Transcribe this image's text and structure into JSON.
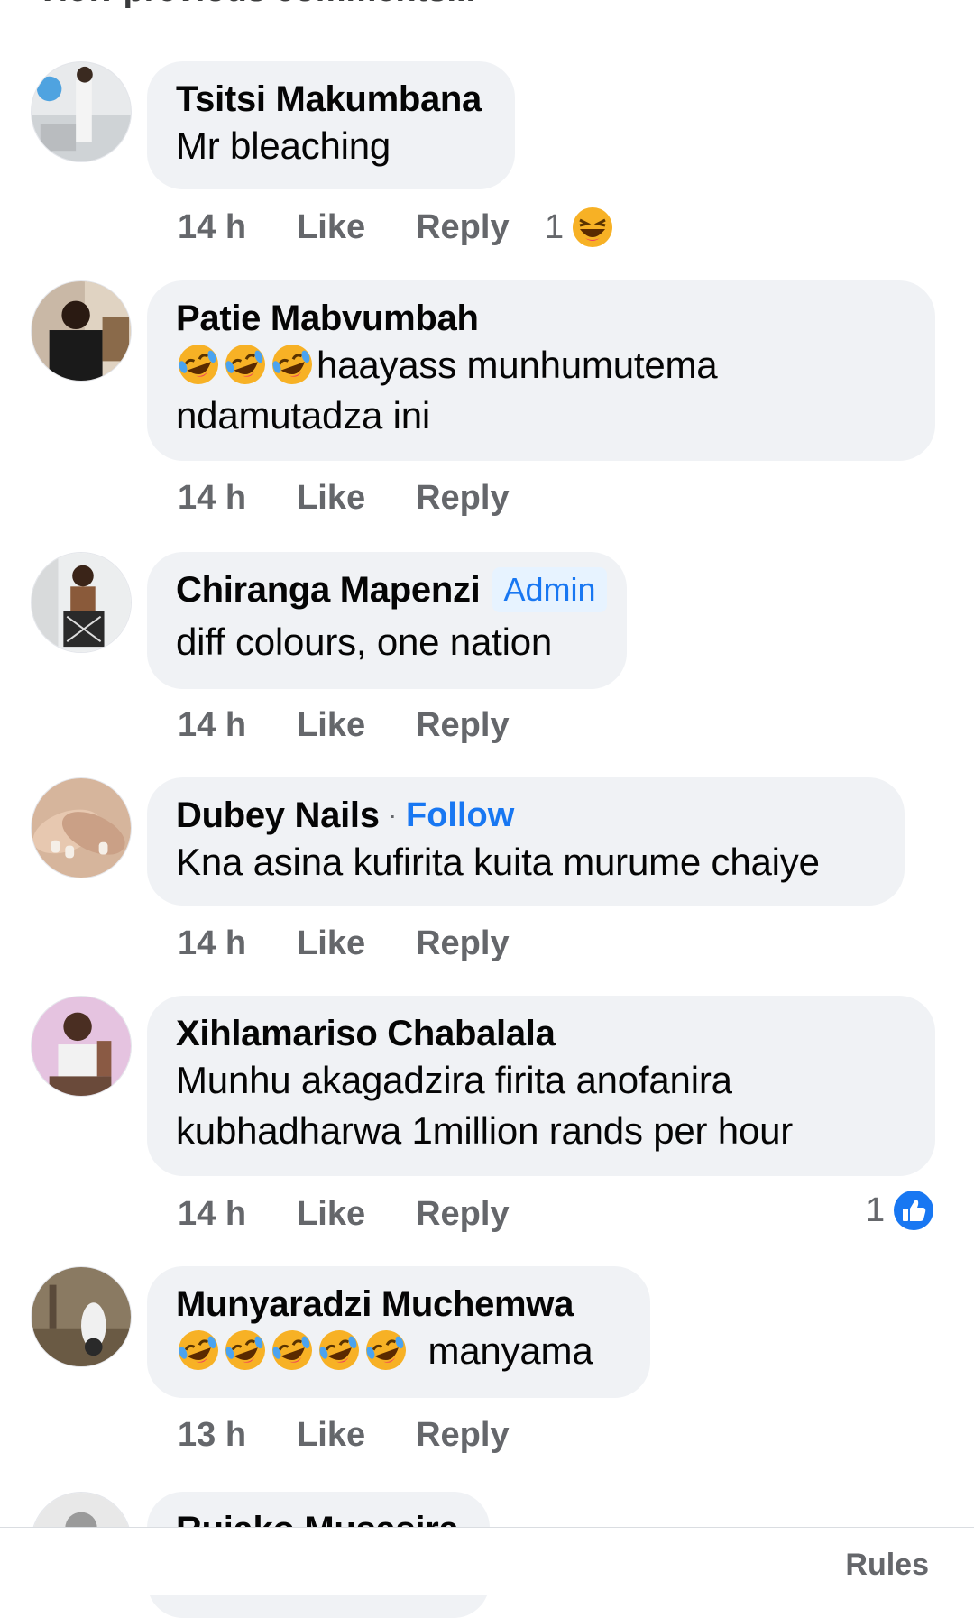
{
  "header": {
    "partial_text": "View previous comments..."
  },
  "comments": [
    {
      "author": "Tsitsi Makumbana",
      "text_lines": [
        "Mr bleaching"
      ],
      "time": "14 h",
      "like_label": "Like",
      "reply_label": "Reply",
      "reaction_count": "1",
      "reaction_icon": "haha-icon"
    },
    {
      "author": "Patie Mabvumbah",
      "text_lines": [
        "haayass munhumutema",
        "ndamutadza ini"
      ],
      "emoji_prefix_count": 3,
      "emoji_name": "rolling-on-floor-laughing-emoji",
      "time": "14 h",
      "like_label": "Like",
      "reply_label": "Reply"
    },
    {
      "author": "Chiranga Mapenzi",
      "badge": "Admin",
      "text_lines": [
        "diff colours, one nation"
      ],
      "time": "14 h",
      "like_label": "Like",
      "reply_label": "Reply"
    },
    {
      "author": "Dubey Nails",
      "separator": "·",
      "follow_label": "Follow",
      "text_lines": [
        "Kna asina kufirita kuita murume chaiye"
      ],
      "time": "14 h",
      "like_label": "Like",
      "reply_label": "Reply"
    },
    {
      "author": "Xihlamariso Chabalala",
      "text_lines": [
        "Munhu akagadzira firita anofanira",
        "kubhadharwa 1million rands per hour"
      ],
      "time": "14 h",
      "like_label": "Like",
      "reply_label": "Reply",
      "reaction_count": "1",
      "reaction_icon": "thumbs-up-icon"
    },
    {
      "author": "Munyaradzi Muchemwa",
      "text_lines": [
        "manyama"
      ],
      "emoji_prefix_count": 5,
      "emoji_name": "rolling-on-floor-laughing-emoji",
      "time": "13 h",
      "like_label": "Like",
      "reply_label": "Reply"
    },
    {
      "author": "Ruiako Musasira"
    }
  ],
  "footer": {
    "rules_label": "Rules"
  },
  "colors": {
    "bubble": "#f0f2f5",
    "meta": "#65676b",
    "link": "#1877f2",
    "admin_badge_bg": "#e7f3ff"
  }
}
